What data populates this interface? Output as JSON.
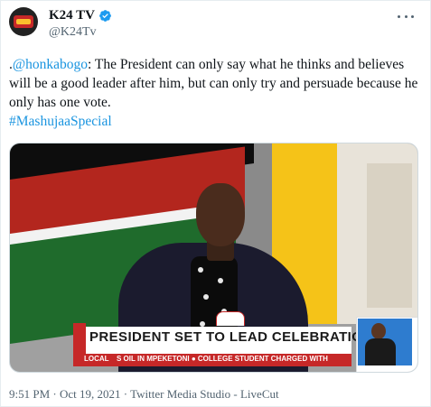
{
  "author": {
    "display_name": "K24 TV",
    "handle": "@K24Tv",
    "verified": true,
    "verified_color": "#1d9bf0"
  },
  "tweet": {
    "text_prefix": ".",
    "mention": "@honkabogo",
    "text_body": ": The President can only say what he thinks and believes will be a good leader after him, but can only try and persuade because he only has one vote.",
    "hashtag": "#MashujaaSpecial",
    "link_color": "#1b95e0"
  },
  "media": {
    "headline": "PRESIDENT SET TO LEAD CELEBRATIONS",
    "ticker_label": "LOCAL",
    "ticker_text": "S OIL IN MPEKETONI  ● COLLEGE STUDENT CHARGED WITH"
  },
  "footer": {
    "time": "9:51 PM",
    "separator1": " · ",
    "date": "Oct 19, 2021",
    "separator2": " · ",
    "source": "Twitter Media Studio - LiveCut"
  },
  "icons": {
    "verified": "verified-badge-icon",
    "more": "more-options-icon"
  }
}
